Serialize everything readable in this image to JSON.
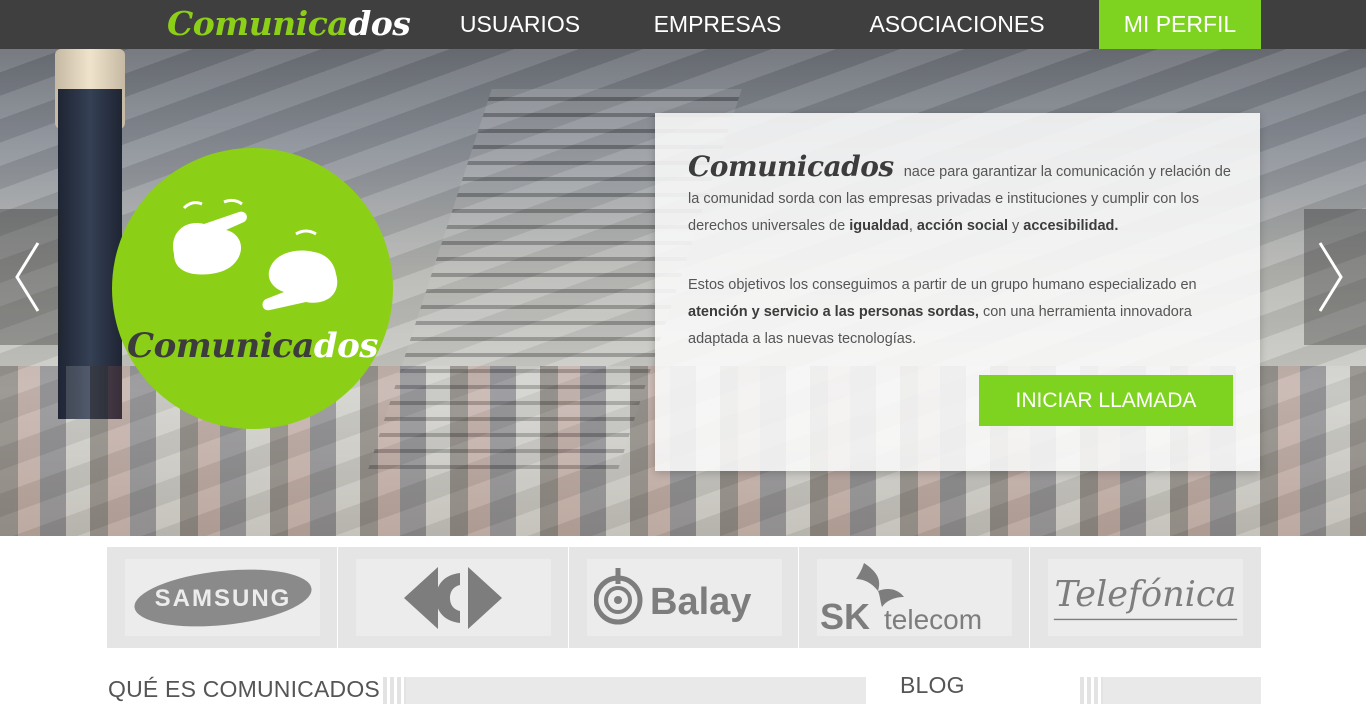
{
  "nav": {
    "logo_part1": "Comunica",
    "logo_part2": "dos",
    "items": [
      {
        "label": "USUARIOS"
      },
      {
        "label": "EMPRESAS"
      },
      {
        "label": "ASOCIACIONES"
      },
      {
        "label": "MI PERFIL",
        "active": true
      }
    ]
  },
  "hero": {
    "badge_part1": "Comunica",
    "badge_part2": "dos",
    "panel": {
      "brand": "Comunicados",
      "p1_text": "nace para garantizar la comunicación y relación de la comunidad sorda con las empresas privadas e instituciones y cumplir con los derechos universales de",
      "p1_bold1": "igualdad",
      "p1_sep1": ",",
      "p1_bold2": "acción social",
      "p1_sep2": "y",
      "p1_bold3": "accesibilidad.",
      "p2_text1": "Estos objetivos los conseguimos a partir de un grupo humano especializado en",
      "p2_bold": "atención y servicio a las personas sordas,",
      "p2_text2": "con una herramienta innovadora adaptada a las nuevas tecnologías.",
      "cta_label": "INICIAR LLAMADA"
    }
  },
  "partners": [
    {
      "name": "SAMSUNG"
    },
    {
      "name": "Carrefour"
    },
    {
      "name": "Balay"
    },
    {
      "name_sk": "SK",
      "name_telecom": "telecom"
    },
    {
      "name": "Telefónica"
    }
  ],
  "sections": {
    "que_es": "QUÉ ES COMUNICADOS",
    "blog": "BLOG"
  },
  "colors": {
    "accent": "#7ed321",
    "nav_bg": "#3f3f3f"
  }
}
